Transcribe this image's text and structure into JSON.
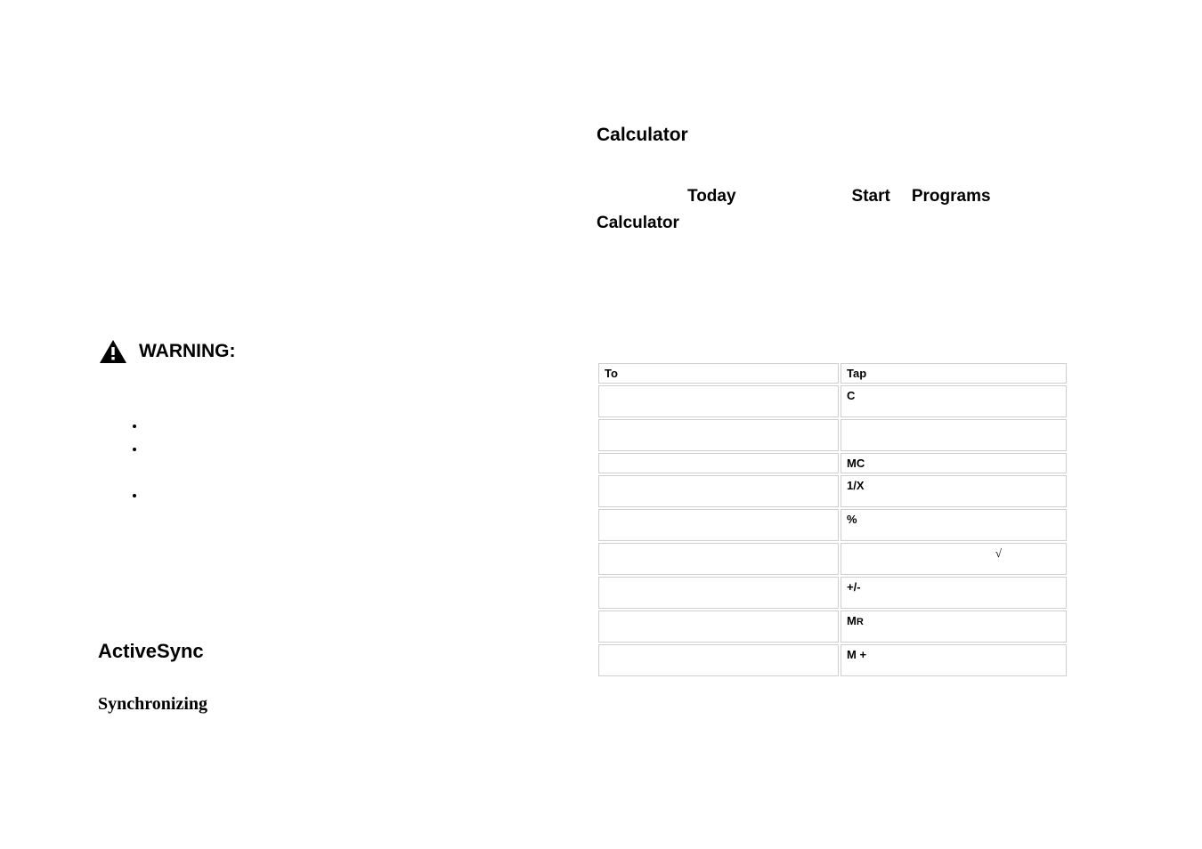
{
  "left": {
    "warning_label": "WARNING:",
    "bullets": [
      "",
      "",
      ""
    ],
    "activesync": "ActiveSync",
    "synchronizing": "Synchronizing"
  },
  "right": {
    "calculator_title": "Calculator",
    "nav": {
      "today": "Today",
      "start": "Start",
      "programs": "Programs",
      "calculator": "Calculator"
    },
    "table": {
      "header_to": "To",
      "header_tap": "Tap",
      "rows": [
        {
          "to": "",
          "tap": "C",
          "short": false
        },
        {
          "to": "",
          "tap": "",
          "short": false
        },
        {
          "to": "",
          "tap": "MC",
          "short": true
        },
        {
          "to": "",
          "tap": "1/X",
          "short": false
        },
        {
          "to": "",
          "tap": "%",
          "short": false
        },
        {
          "to": "",
          "tap": "√",
          "short": false,
          "sqrt": true
        },
        {
          "to": "",
          "tap": "+/-",
          "short": false
        },
        {
          "to": "",
          "tap_prefix": "M",
          "tap_suffix": "R",
          "short": false,
          "mr": true
        },
        {
          "to": "",
          "tap": "M +",
          "short": false
        }
      ]
    }
  }
}
